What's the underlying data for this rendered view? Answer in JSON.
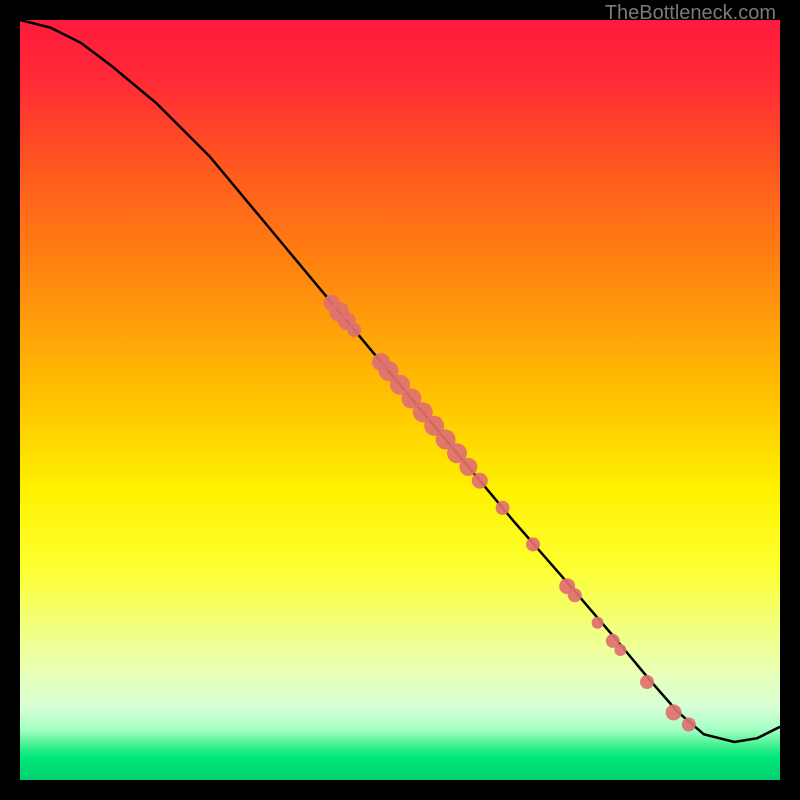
{
  "attribution": "TheBottleneck.com",
  "chart_data": {
    "type": "line",
    "title": "",
    "xlabel": "",
    "ylabel": "",
    "xlim": [
      0,
      100
    ],
    "ylim": [
      0,
      100
    ],
    "background_gradient_stops": [
      {
        "offset": 0.0,
        "color": "#ff1a3e"
      },
      {
        "offset": 0.08,
        "color": "#ff2a36"
      },
      {
        "offset": 0.2,
        "color": "#ff5a1e"
      },
      {
        "offset": 0.35,
        "color": "#ff8c0e"
      },
      {
        "offset": 0.5,
        "color": "#ffc300"
      },
      {
        "offset": 0.62,
        "color": "#fff200"
      },
      {
        "offset": 0.72,
        "color": "#fdff30"
      },
      {
        "offset": 0.8,
        "color": "#f2ff80"
      },
      {
        "offset": 0.86,
        "color": "#e8ffb8"
      },
      {
        "offset": 0.905,
        "color": "#d6ffd6"
      },
      {
        "offset": 0.935,
        "color": "#a0ffc0"
      },
      {
        "offset": 0.955,
        "color": "#40f090"
      },
      {
        "offset": 0.97,
        "color": "#00e878"
      },
      {
        "offset": 1.0,
        "color": "#00d070"
      }
    ],
    "series": [
      {
        "name": "curve",
        "x": [
          0,
          4,
          8,
          12,
          18,
          25,
          35,
          45,
          55,
          65,
          72,
          78,
          83,
          86.5,
          90,
          94,
          97,
          100
        ],
        "y": [
          100,
          99,
          97,
          94,
          89,
          82,
          70,
          58,
          46,
          34,
          26,
          19,
          13,
          9,
          6,
          5,
          5.5,
          7
        ]
      }
    ],
    "scatter_points": {
      "name": "markers",
      "color": "#e07070",
      "points": [
        {
          "x": 41.0,
          "y": 62.8,
          "r": 8
        },
        {
          "x": 42.0,
          "y": 61.6,
          "r": 10
        },
        {
          "x": 43.0,
          "y": 60.4,
          "r": 9
        },
        {
          "x": 44.0,
          "y": 59.2,
          "r": 7
        },
        {
          "x": 47.5,
          "y": 55.0,
          "r": 9
        },
        {
          "x": 48.5,
          "y": 53.8,
          "r": 10
        },
        {
          "x": 50.0,
          "y": 52.0,
          "r": 10
        },
        {
          "x": 51.5,
          "y": 50.2,
          "r": 10
        },
        {
          "x": 53.0,
          "y": 48.4,
          "r": 10
        },
        {
          "x": 54.5,
          "y": 46.6,
          "r": 10
        },
        {
          "x": 56.0,
          "y": 44.8,
          "r": 10
        },
        {
          "x": 57.5,
          "y": 43.0,
          "r": 10
        },
        {
          "x": 59.0,
          "y": 41.2,
          "r": 9
        },
        {
          "x": 60.5,
          "y": 39.4,
          "r": 8
        },
        {
          "x": 63.5,
          "y": 35.8,
          "r": 7
        },
        {
          "x": 67.5,
          "y": 31.0,
          "r": 7
        },
        {
          "x": 72.0,
          "y": 25.5,
          "r": 8
        },
        {
          "x": 73.0,
          "y": 24.3,
          "r": 7
        },
        {
          "x": 76.0,
          "y": 20.7,
          "r": 6
        },
        {
          "x": 78.0,
          "y": 18.3,
          "r": 7
        },
        {
          "x": 79.0,
          "y": 17.1,
          "r": 6
        },
        {
          "x": 82.5,
          "y": 12.9,
          "r": 7
        },
        {
          "x": 86.0,
          "y": 8.9,
          "r": 8
        },
        {
          "x": 88.0,
          "y": 7.3,
          "r": 7
        }
      ]
    }
  }
}
